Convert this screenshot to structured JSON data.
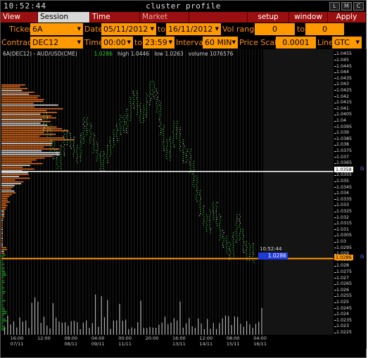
{
  "title_bar": {
    "clock": "10:52:44",
    "title": "cluster profile",
    "buttons": [
      "L",
      "M",
      "C"
    ]
  },
  "menu": {
    "view_dom": "View DOM",
    "session_hours": "Session Hours",
    "time_interval": "Time Interval",
    "market_watch": "Market Watch",
    "setup": "setup",
    "window": "window",
    "apply": "Apply"
  },
  "controls": {
    "ticker_label": "Ticker",
    "ticker": "6A",
    "date_label": "Date",
    "date_from": "05/11/2012",
    "to_label": "to",
    "date_to": "16/11/2012",
    "vol_range_label": "Vol range",
    "vol_from": "0",
    "vol_to_label": "to",
    "vol_to": "0",
    "contract_label": "Contract",
    "contract": "DEC12",
    "time_label": "Time",
    "time_from": "00:00",
    "time_to_label": "to",
    "time_to": "23:59",
    "interval_label": "Interval",
    "interval": "60 MIN",
    "price_scale_label": "Price Scale",
    "price_scale": "0.0001",
    "line_label": "Line",
    "line": "GTC"
  },
  "chart_header": {
    "symbol": "6A(DEC12) - AUD/USD(CME)",
    "last": "1.0286",
    "high_label": "high",
    "high": "1.0446",
    "low_label": "low",
    "low": "1.0263",
    "volume_label": "volume",
    "volume": "1076576"
  },
  "markers": {
    "line1_price": "1.0358",
    "line2_price": "1.0286",
    "time_box": "10:52:44",
    "last_price_box": "1.0286",
    "line2_right": "1.0286",
    "flag": "G"
  },
  "chart_data": {
    "type": "line",
    "title": "",
    "y_ticks": [
      "1.0455",
      "1.045",
      "1.0445",
      "1.044",
      "1.0435",
      "1.043",
      "1.0425",
      "1.042",
      "1.0415",
      "1.041",
      "1.0405",
      "1.04",
      "1.0395",
      "1.039",
      "1.0385",
      "1.038",
      "1.0375",
      "1.037",
      "1.0365",
      "1.036",
      "1.0355",
      "1.035",
      "1.0345",
      "1.034",
      "1.0335",
      "1.033",
      "1.0325",
      "1.032",
      "1.0315",
      "1.031",
      "1.0305",
      "1.03",
      "1.0295",
      "1.029",
      "1.0285",
      "1.028",
      "1.0275",
      "1.027",
      "1.0265",
      "1.026",
      "1.0255",
      "1.025",
      "1.0245",
      "1.024",
      "1.0235",
      "1.023",
      "1.0225"
    ],
    "ylim": [
      1.0223,
      1.0459
    ],
    "x_ticks": [
      {
        "time": "16:00",
        "date": "07/11"
      },
      {
        "time": "12:00",
        "date": ""
      },
      {
        "time": "08:00",
        "date": "08/11"
      },
      {
        "time": "04:00",
        "date": "09/11"
      },
      {
        "time": "00:00",
        "date": "11/11"
      },
      {
        "time": "20:00",
        "date": ""
      },
      {
        "time": "16:00",
        "date": "13/11"
      },
      {
        "time": "12:00",
        "date": "14/11"
      },
      {
        "time": "08:00",
        "date": "15/11"
      },
      {
        "time": "04:00",
        "date": "16/11"
      }
    ],
    "price_path": [
      1.0395,
      1.0402,
      1.0392,
      1.038,
      1.0372,
      1.0365,
      1.0375,
      1.0388,
      1.0385,
      1.0382,
      1.0375,
      1.037,
      1.0385,
      1.0398,
      1.0393,
      1.0385,
      1.0378,
      1.037,
      1.0362,
      1.037,
      1.0375,
      1.0382,
      1.0388,
      1.0393,
      1.04,
      1.0395,
      1.0405,
      1.0415,
      1.042,
      1.041,
      1.0402,
      1.0408,
      1.0418,
      1.0428,
      1.0422,
      1.0412,
      1.0392,
      1.038,
      1.0372,
      1.0382,
      1.0395,
      1.039,
      1.038,
      1.037,
      1.0372,
      1.0362,
      1.035,
      1.0338,
      1.0325,
      1.0318,
      1.0312,
      1.0322,
      1.0328,
      1.0318,
      1.0305,
      1.03,
      1.0295,
      1.029,
      1.0303,
      1.0318,
      1.0306,
      1.0296,
      1.0288,
      1.0294,
      1.0286
    ]
  }
}
